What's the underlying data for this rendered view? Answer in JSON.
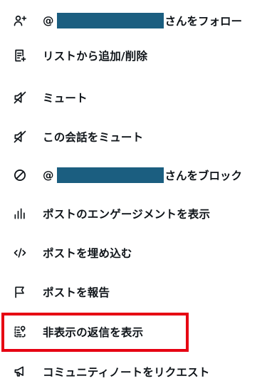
{
  "menu": {
    "items": [
      {
        "icon": "follow-user-icon",
        "prefix": "@",
        "suffix": "さんをフォロー"
      },
      {
        "icon": "list-add-icon",
        "label": "リストから追加/削除"
      },
      {
        "icon": "mute-icon",
        "label": "ミュート"
      },
      {
        "icon": "mute-conversation-icon",
        "label": "この会話をミュート"
      },
      {
        "icon": "block-icon",
        "prefix": "@",
        "suffix": "さんをブロック"
      },
      {
        "icon": "analytics-icon",
        "label": "ポストのエンゲージメントを表示"
      },
      {
        "icon": "embed-icon",
        "label": "ポストを埋め込む"
      },
      {
        "icon": "report-flag-icon",
        "label": "ポストを報告"
      },
      {
        "icon": "hidden-replies-icon",
        "label": "非表示の返信を表示"
      },
      {
        "icon": "community-notes-icon",
        "label": "コミュニティノートをリクエスト"
      }
    ]
  },
  "colors": {
    "text": "#0f1419",
    "redaction": "#1b5e80",
    "highlight_border": "#e60012",
    "background": "#ffffff"
  }
}
